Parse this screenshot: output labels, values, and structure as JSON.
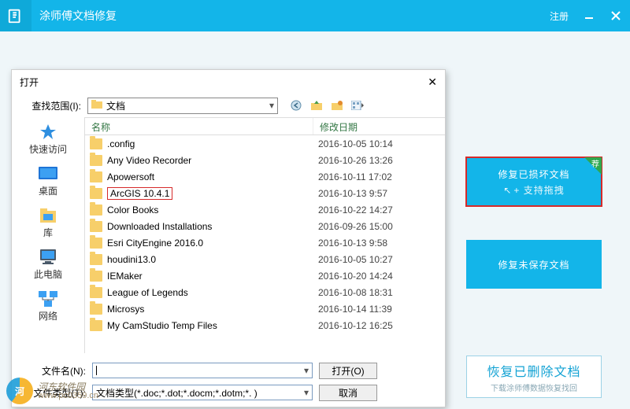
{
  "titlebar": {
    "app_name": "涂师傅文档修复",
    "register": "注册"
  },
  "tiles": {
    "repair_damaged": "修复已损坏文档",
    "repair_damaged_sub": "+ 支持拖拽",
    "corner": "荐",
    "repair_unsaved": "修复未保存文档",
    "recover_deleted": "恢复已删除文档",
    "recover_deleted_sub": "下载涂师傅数据恢复找回"
  },
  "dialog": {
    "title": "打开",
    "lookin_label": "查找范围(I):",
    "lookin_value": "文档",
    "headers": {
      "name": "名称",
      "date": "修改日期"
    },
    "rows": [
      {
        "name": ".config",
        "date": "2016-10-05 10:14"
      },
      {
        "name": "Any Video Recorder",
        "date": "2016-10-26 13:26"
      },
      {
        "name": "Apowersoft",
        "date": "2016-10-11 17:02"
      },
      {
        "name": "ArcGIS 10.4.1",
        "date": "2016-10-13 9:57"
      },
      {
        "name": "Color Books",
        "date": "2016-10-22 14:27"
      },
      {
        "name": "Downloaded Installations",
        "date": "2016-09-26 15:00"
      },
      {
        "name": "Esri CityEngine 2016.0",
        "date": "2016-10-13 9:58"
      },
      {
        "name": "houdini13.0",
        "date": "2016-10-05 10:27"
      },
      {
        "name": "IEMaker",
        "date": "2016-10-20 14:24"
      },
      {
        "name": "League of Legends",
        "date": "2016-10-08 18:31"
      },
      {
        "name": "Microsys",
        "date": "2016-10-14 11:39"
      },
      {
        "name": "My CamStudio Temp Files",
        "date": "2016-10-12 16:25"
      }
    ],
    "places": {
      "quick": "快速访问",
      "desktop": "桌面",
      "libraries": "库",
      "computer": "此电脑",
      "network": "网络"
    },
    "filename_label": "文件名(N):",
    "filename_value": "",
    "filetype_label": "文件类型(T):",
    "filetype_value": "文档类型(*.doc;*.dot;*.docm;*.dotm;*. )",
    "open_btn": "打开(O)",
    "cancel_btn": "取消"
  },
  "watermark": {
    "name": "河东软件园",
    "url": "www.pc0359.cn"
  }
}
